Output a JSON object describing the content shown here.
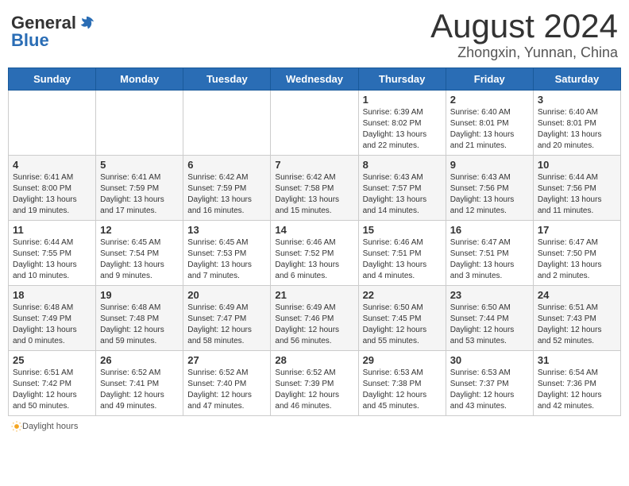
{
  "header": {
    "logo_general": "General",
    "logo_blue": "Blue",
    "month_title": "August 2024",
    "location": "Zhongxin, Yunnan, China"
  },
  "weekdays": [
    "Sunday",
    "Monday",
    "Tuesday",
    "Wednesday",
    "Thursday",
    "Friday",
    "Saturday"
  ],
  "weeks": [
    [
      {
        "day": "",
        "info": ""
      },
      {
        "day": "",
        "info": ""
      },
      {
        "day": "",
        "info": ""
      },
      {
        "day": "",
        "info": ""
      },
      {
        "day": "1",
        "info": "Sunrise: 6:39 AM\nSunset: 8:02 PM\nDaylight: 13 hours and 22 minutes."
      },
      {
        "day": "2",
        "info": "Sunrise: 6:40 AM\nSunset: 8:01 PM\nDaylight: 13 hours and 21 minutes."
      },
      {
        "day": "3",
        "info": "Sunrise: 6:40 AM\nSunset: 8:01 PM\nDaylight: 13 hours and 20 minutes."
      }
    ],
    [
      {
        "day": "4",
        "info": "Sunrise: 6:41 AM\nSunset: 8:00 PM\nDaylight: 13 hours and 19 minutes."
      },
      {
        "day": "5",
        "info": "Sunrise: 6:41 AM\nSunset: 7:59 PM\nDaylight: 13 hours and 17 minutes."
      },
      {
        "day": "6",
        "info": "Sunrise: 6:42 AM\nSunset: 7:59 PM\nDaylight: 13 hours and 16 minutes."
      },
      {
        "day": "7",
        "info": "Sunrise: 6:42 AM\nSunset: 7:58 PM\nDaylight: 13 hours and 15 minutes."
      },
      {
        "day": "8",
        "info": "Sunrise: 6:43 AM\nSunset: 7:57 PM\nDaylight: 13 hours and 14 minutes."
      },
      {
        "day": "9",
        "info": "Sunrise: 6:43 AM\nSunset: 7:56 PM\nDaylight: 13 hours and 12 minutes."
      },
      {
        "day": "10",
        "info": "Sunrise: 6:44 AM\nSunset: 7:56 PM\nDaylight: 13 hours and 11 minutes."
      }
    ],
    [
      {
        "day": "11",
        "info": "Sunrise: 6:44 AM\nSunset: 7:55 PM\nDaylight: 13 hours and 10 minutes."
      },
      {
        "day": "12",
        "info": "Sunrise: 6:45 AM\nSunset: 7:54 PM\nDaylight: 13 hours and 9 minutes."
      },
      {
        "day": "13",
        "info": "Sunrise: 6:45 AM\nSunset: 7:53 PM\nDaylight: 13 hours and 7 minutes."
      },
      {
        "day": "14",
        "info": "Sunrise: 6:46 AM\nSunset: 7:52 PM\nDaylight: 13 hours and 6 minutes."
      },
      {
        "day": "15",
        "info": "Sunrise: 6:46 AM\nSunset: 7:51 PM\nDaylight: 13 hours and 4 minutes."
      },
      {
        "day": "16",
        "info": "Sunrise: 6:47 AM\nSunset: 7:51 PM\nDaylight: 13 hours and 3 minutes."
      },
      {
        "day": "17",
        "info": "Sunrise: 6:47 AM\nSunset: 7:50 PM\nDaylight: 13 hours and 2 minutes."
      }
    ],
    [
      {
        "day": "18",
        "info": "Sunrise: 6:48 AM\nSunset: 7:49 PM\nDaylight: 13 hours and 0 minutes."
      },
      {
        "day": "19",
        "info": "Sunrise: 6:48 AM\nSunset: 7:48 PM\nDaylight: 12 hours and 59 minutes."
      },
      {
        "day": "20",
        "info": "Sunrise: 6:49 AM\nSunset: 7:47 PM\nDaylight: 12 hours and 58 minutes."
      },
      {
        "day": "21",
        "info": "Sunrise: 6:49 AM\nSunset: 7:46 PM\nDaylight: 12 hours and 56 minutes."
      },
      {
        "day": "22",
        "info": "Sunrise: 6:50 AM\nSunset: 7:45 PM\nDaylight: 12 hours and 55 minutes."
      },
      {
        "day": "23",
        "info": "Sunrise: 6:50 AM\nSunset: 7:44 PM\nDaylight: 12 hours and 53 minutes."
      },
      {
        "day": "24",
        "info": "Sunrise: 6:51 AM\nSunset: 7:43 PM\nDaylight: 12 hours and 52 minutes."
      }
    ],
    [
      {
        "day": "25",
        "info": "Sunrise: 6:51 AM\nSunset: 7:42 PM\nDaylight: 12 hours and 50 minutes."
      },
      {
        "day": "26",
        "info": "Sunrise: 6:52 AM\nSunset: 7:41 PM\nDaylight: 12 hours and 49 minutes."
      },
      {
        "day": "27",
        "info": "Sunrise: 6:52 AM\nSunset: 7:40 PM\nDaylight: 12 hours and 47 minutes."
      },
      {
        "day": "28",
        "info": "Sunrise: 6:52 AM\nSunset: 7:39 PM\nDaylight: 12 hours and 46 minutes."
      },
      {
        "day": "29",
        "info": "Sunrise: 6:53 AM\nSunset: 7:38 PM\nDaylight: 12 hours and 45 minutes."
      },
      {
        "day": "30",
        "info": "Sunrise: 6:53 AM\nSunset: 7:37 PM\nDaylight: 12 hours and 43 minutes."
      },
      {
        "day": "31",
        "info": "Sunrise: 6:54 AM\nSunset: 7:36 PM\nDaylight: 12 hours and 42 minutes."
      }
    ]
  ],
  "footer": {
    "daylight_label": "Daylight hours"
  }
}
